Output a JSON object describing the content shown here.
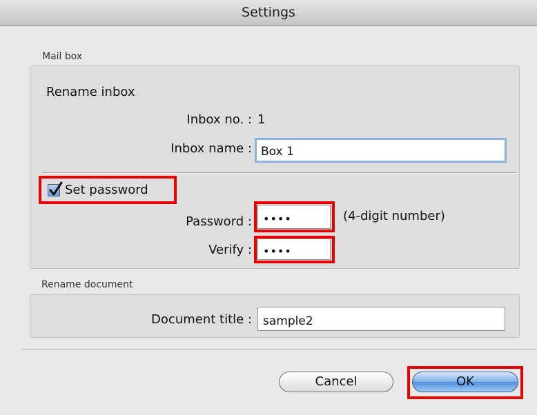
{
  "window": {
    "title": "Settings"
  },
  "mailbox": {
    "group_label": "Mail box",
    "section_title": "Rename inbox",
    "inbox_no_label": "Inbox no. :",
    "inbox_no_value": "1",
    "inbox_name_label": "Inbox name :",
    "inbox_name_value": "Box 1",
    "set_password_label": "Set password",
    "set_password_checked": true,
    "password_label": "Password :",
    "password_masked": "••••",
    "password_hint": "(4-digit number)",
    "verify_label": "Verify :",
    "verify_masked": "••••"
  },
  "document": {
    "group_label": "Rename document",
    "title_label": "Document title :",
    "title_value": "sample2"
  },
  "buttons": {
    "cancel": "Cancel",
    "ok": "OK"
  },
  "colors": {
    "highlight": "#e60000",
    "focus_ring": "#8cb3e0",
    "default_button": "#4f91de"
  }
}
